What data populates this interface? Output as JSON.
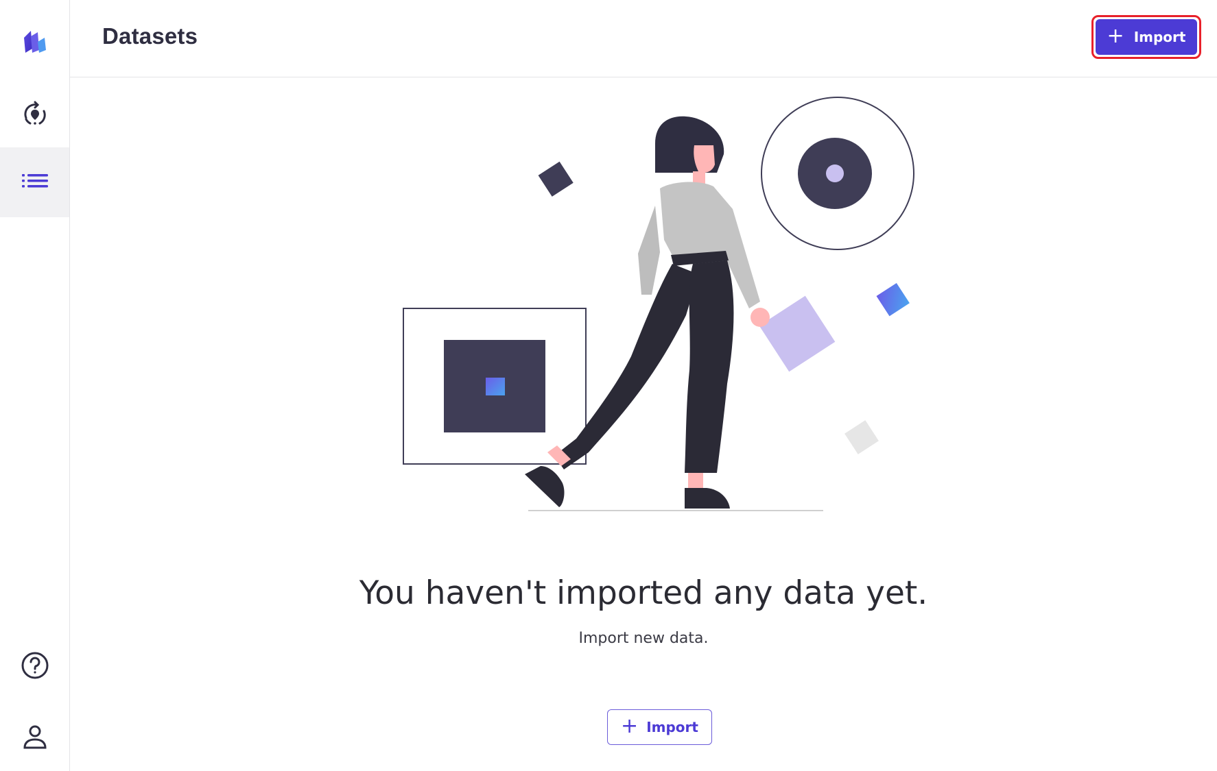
{
  "header": {
    "title": "Datasets",
    "import_button_label": "Import"
  },
  "sidebar": {
    "items": [
      {
        "icon": "app-logo-icon"
      },
      {
        "icon": "model-refresh-icon"
      },
      {
        "icon": "datasets-list-icon",
        "active": true
      },
      {
        "icon": "help-icon"
      },
      {
        "icon": "user-profile-icon"
      }
    ]
  },
  "empty_state": {
    "heading": "You haven't imported any data yet.",
    "subtext": "Import new data.",
    "button_label": "Import",
    "illustration": "woman-walking-with-shapes-illustration"
  },
  "colors": {
    "accent": "#4c3bd5",
    "highlight_border": "#e8202a",
    "dark_shape": "#3f3d56",
    "lavender": "#c9c0f0",
    "active_nav_bg": "#f1f1f3"
  }
}
